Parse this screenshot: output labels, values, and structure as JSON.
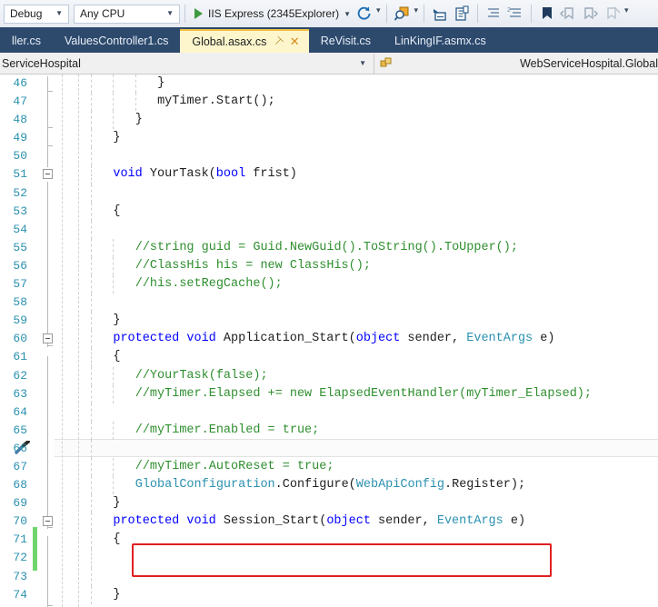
{
  "toolbar": {
    "configuration": "Debug",
    "platform": "Any CPU",
    "run_target": "IIS Express (2345Explorer)"
  },
  "tabs": [
    {
      "label": "ller.cs"
    },
    {
      "label": "ValuesController1.cs"
    },
    {
      "label": "Global.asax.cs"
    },
    {
      "label": "ReVisit.cs"
    },
    {
      "label": "LinKingIF.asmx.cs"
    }
  ],
  "navbar": {
    "project": "ServiceHospital",
    "type": "WebServiceHospital.Global"
  },
  "editor": {
    "current_line": 62,
    "accent_comment_color": "#2f8f2f",
    "accent_keyword_color": "#0000ff",
    "accent_type_color": "#2b91af",
    "annotation_color": "#e02020",
    "change_marker_color": "#6fd66f",
    "lines": [
      {
        "n": 46,
        "indent": 9,
        "tokens": [
          {
            "t": "}",
            "c": "p"
          }
        ]
      },
      {
        "n": 47,
        "indent": 9,
        "tokens": [
          {
            "t": "myTimer.Start();",
            "c": "p"
          }
        ]
      },
      {
        "n": 48,
        "indent": 6,
        "tokens": [
          {
            "t": "}",
            "c": "p"
          }
        ]
      },
      {
        "n": 49,
        "indent": 3,
        "tokens": [
          {
            "t": "}",
            "c": "p"
          }
        ]
      },
      {
        "n": 50,
        "indent": 0,
        "tokens": []
      },
      {
        "n": 51,
        "indent": 3,
        "tokens": [
          {
            "t": "void ",
            "c": "k"
          },
          {
            "t": "YourTask(",
            "c": "p"
          },
          {
            "t": "bool",
            "c": "k"
          },
          {
            "t": " frist)",
            "c": "p"
          }
        ]
      },
      {
        "n": 52,
        "indent": 0,
        "tokens": []
      },
      {
        "n": 53,
        "indent": 3,
        "tokens": [
          {
            "t": "{",
            "c": "p"
          }
        ]
      },
      {
        "n": 54,
        "indent": 0,
        "tokens": []
      },
      {
        "n": 55,
        "indent": 6,
        "tokens": [
          {
            "t": "//string guid = Guid.NewGuid().ToString().ToUpper();",
            "c": "c"
          }
        ]
      },
      {
        "n": 56,
        "indent": 6,
        "tokens": [
          {
            "t": "//ClassHis his = new ClassHis();",
            "c": "c"
          }
        ]
      },
      {
        "n": 57,
        "indent": 6,
        "tokens": [
          {
            "t": "//his.setRegCache();",
            "c": "c"
          }
        ]
      },
      {
        "n": 58,
        "indent": 0,
        "tokens": []
      },
      {
        "n": 59,
        "indent": 3,
        "tokens": [
          {
            "t": "}",
            "c": "p"
          }
        ]
      },
      {
        "n": 60,
        "indent": 3,
        "tokens": [
          {
            "t": "protected void ",
            "c": "k"
          },
          {
            "t": "Application_Start(",
            "c": "p"
          },
          {
            "t": "object",
            "c": "k"
          },
          {
            "t": " sender, ",
            "c": "p"
          },
          {
            "t": "EventArgs",
            "c": "t"
          },
          {
            "t": " e)",
            "c": "p"
          }
        ]
      },
      {
        "n": 61,
        "indent": 3,
        "tokens": [
          {
            "t": "{",
            "c": "p"
          }
        ]
      },
      {
        "n": 62,
        "indent": 6,
        "tokens": [
          {
            "t": "//YourTask(false);",
            "c": "c"
          }
        ]
      },
      {
        "n": 63,
        "indent": 6,
        "tokens": [
          {
            "t": "//myTimer.Elapsed += new ElapsedEventHandler(myTimer_Elapsed);",
            "c": "c"
          }
        ]
      },
      {
        "n": 64,
        "indent": 0,
        "tokens": []
      },
      {
        "n": 65,
        "indent": 6,
        "tokens": [
          {
            "t": "//myTimer.Enabled = true;",
            "c": "c"
          }
        ]
      },
      {
        "n": 66,
        "indent": 0,
        "tokens": []
      },
      {
        "n": 67,
        "indent": 6,
        "tokens": [
          {
            "t": "//myTimer.AutoReset = true;",
            "c": "c"
          }
        ]
      },
      {
        "n": 68,
        "indent": 6,
        "tokens": [
          {
            "t": "GlobalConfiguration",
            "c": "t"
          },
          {
            "t": ".Configure(",
            "c": "p"
          },
          {
            "t": "WebApiConfig",
            "c": "t"
          },
          {
            "t": ".Register);",
            "c": "p"
          }
        ]
      },
      {
        "n": 69,
        "indent": 3,
        "tokens": [
          {
            "t": "}",
            "c": "p"
          }
        ]
      },
      {
        "n": 70,
        "indent": 3,
        "tokens": [
          {
            "t": "protected void ",
            "c": "k"
          },
          {
            "t": "Session_Start(",
            "c": "p"
          },
          {
            "t": "object",
            "c": "k"
          },
          {
            "t": " sender, ",
            "c": "p"
          },
          {
            "t": "EventArgs",
            "c": "t"
          },
          {
            "t": " e)",
            "c": "p"
          }
        ]
      },
      {
        "n": 71,
        "indent": 3,
        "tokens": [
          {
            "t": "{",
            "c": "p"
          }
        ]
      },
      {
        "n": 72,
        "indent": 0,
        "tokens": []
      },
      {
        "n": 73,
        "indent": 0,
        "tokens": []
      },
      {
        "n": 74,
        "indent": 3,
        "tokens": [
          {
            "t": "}",
            "c": "p"
          }
        ]
      }
    ]
  }
}
